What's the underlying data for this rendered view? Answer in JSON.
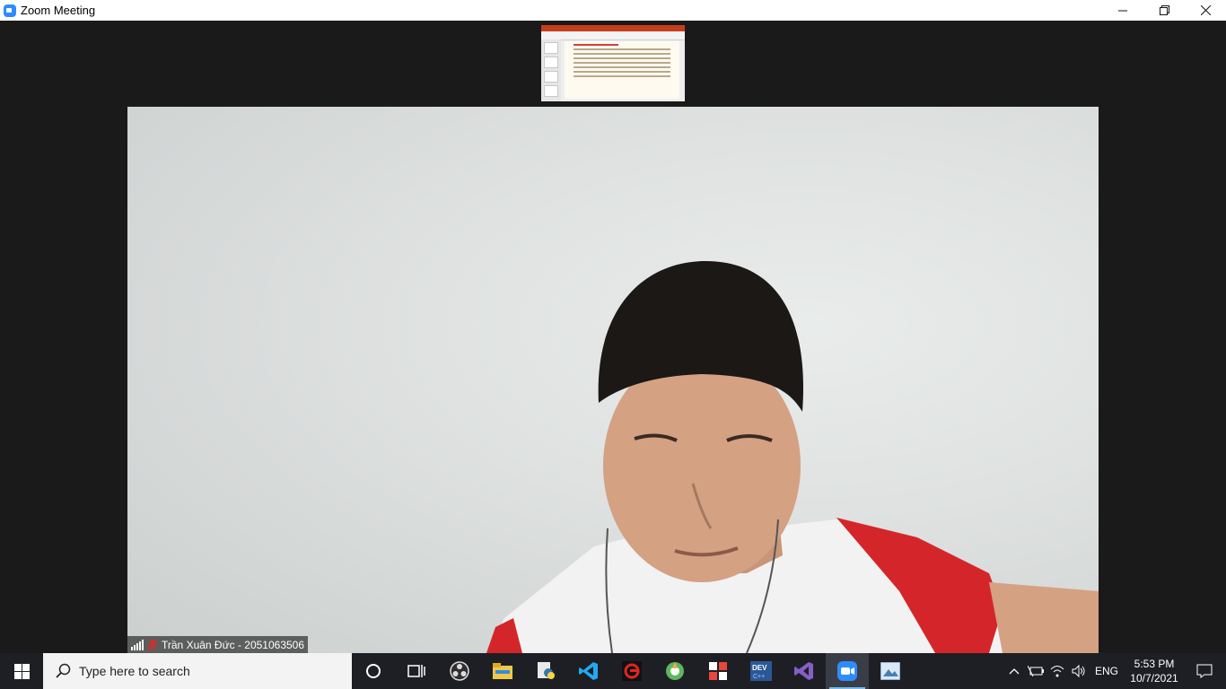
{
  "window": {
    "title": "Zoom Meeting",
    "controls": [
      "minimize-icon",
      "restore-icon",
      "close-icon"
    ]
  },
  "meeting": {
    "participant": {
      "name_label": "Trần Xuân Đức - 2051063506",
      "mic": "muted",
      "signal": "strong"
    },
    "thumbnail": {
      "content": "shared PowerPoint slide"
    }
  },
  "taskbar": {
    "search_placeholder": "Type here to search",
    "apps": [
      {
        "name": "cortana-icon"
      },
      {
        "name": "task-view-icon"
      },
      {
        "name": "obs-icon"
      },
      {
        "name": "file-explorer-icon"
      },
      {
        "name": "python-icon"
      },
      {
        "name": "vscode-icon"
      },
      {
        "name": "garena-icon"
      },
      {
        "name": "app-green-icon"
      },
      {
        "name": "app-grid-icon"
      },
      {
        "name": "devcpp-icon"
      },
      {
        "name": "visual-studio-icon"
      },
      {
        "name": "zoom-icon",
        "active": true
      },
      {
        "name": "image-app-icon"
      }
    ],
    "tray": {
      "language": "ENG",
      "time": "5:53 PM",
      "date": "10/7/2021"
    }
  },
  "colors": {
    "zoom_blue": "#2d8cff",
    "taskbar_bg": "#1e1f24",
    "meeting_bg": "#1a1a1a"
  }
}
